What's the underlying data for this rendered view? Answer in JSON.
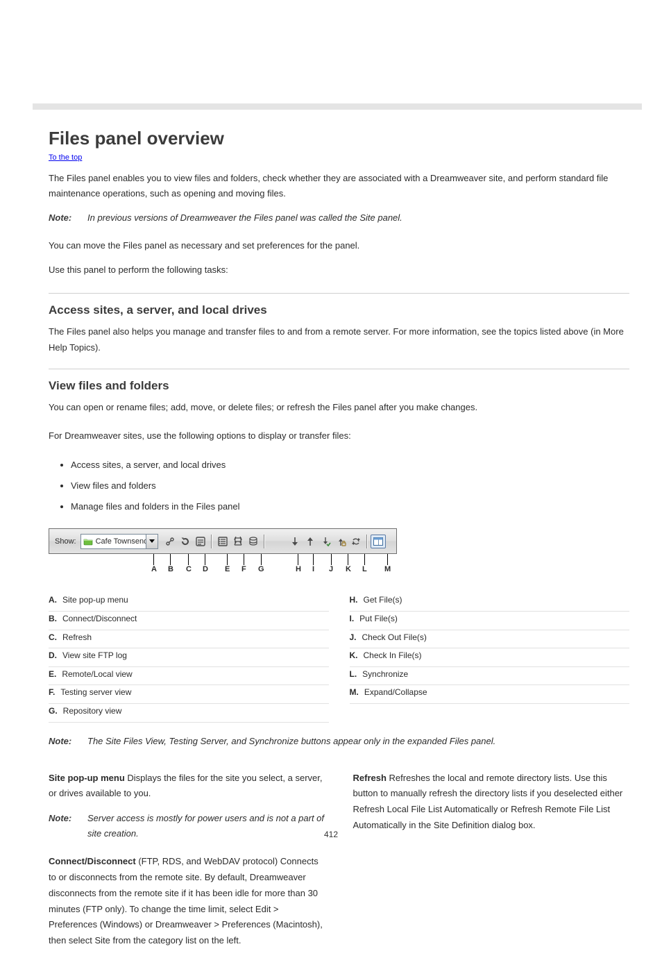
{
  "title": "Files panel overview",
  "breadcrumb_link": "To the top",
  "intro": {
    "p1a": "The Files panel enables you to view files and folders, check whether they are associated with a Dreamweaver site, and perform standard file maintenance operations, such as opening and moving files.",
    "note_label": "Note:",
    "note_body": "In previous versions of Dreamweaver the Files panel was called the Site panel.",
    "p2a": "You can move the Files panel as necessary and set preferences for the panel.",
    "p2b": "Use this panel to perform the following tasks:"
  },
  "section_access": {
    "heading": "Access sites, a server, and local drives",
    "body": "The Files panel also helps you manage and transfer files to and from a remote server. For more information, see the topics listed above (in More Help Topics)."
  },
  "section_options": {
    "heading": "View files and folders",
    "body": "You can open or rename files; add, move, or delete files; or refresh the Files panel after you make changes.",
    "p_after": "For Dreamweaver sites, use the following options to display or transfer files:",
    "bullets": [
      "Access sites, a server, and local drives",
      "View files and folders",
      "Manage files and folders in the Files panel"
    ]
  },
  "toolbar": {
    "show_label": "Show:",
    "dropdown_value": "Cafe Townsend",
    "callouts": [
      "A",
      "B",
      "C",
      "D",
      "E",
      "F",
      "G",
      "H",
      "I",
      "J",
      "K",
      "L",
      "M"
    ]
  },
  "legend": [
    {
      "k": "A.",
      "t": "Site pop-up menu"
    },
    {
      "k": "B.",
      "t": "Connect/Disconnect"
    },
    {
      "k": "C.",
      "t": "Refresh"
    },
    {
      "k": "D.",
      "t": "View site FTP log"
    },
    {
      "k": "E.",
      "t": "Remote/Local view"
    },
    {
      "k": "F.",
      "t": "Testing server view"
    },
    {
      "k": "G.",
      "t": "Repository view"
    },
    {
      "k": "H.",
      "t": "Get File(s)"
    },
    {
      "k": "I.",
      "t": "Put File(s)"
    },
    {
      "k": "J.",
      "t": "Check Out File(s)"
    },
    {
      "k": "K.",
      "t": "Check In File(s)"
    },
    {
      "k": "L.",
      "t": "Synchronize"
    },
    {
      "k": "M.",
      "t": "Expand/Collapse"
    }
  ],
  "postnote_label": "Note:",
  "postnote_body": "The Site Files View, Testing Server, and Synchronize buttons appear only in the expanded Files panel.",
  "defs": {
    "site_popup": {
      "h": "Site pop-up menu",
      "b": "Displays the files for the site you select, a server, or drives available to you."
    },
    "note2_label": "Note:",
    "note2_body": "Server access is mostly for power users and is not a part of site creation.",
    "connect": {
      "h": "Connect/Disconnect",
      "b": "(FTP, RDS, and WebDAV protocol) Connects to or disconnects from the remote site. By default, Dreamweaver disconnects from the remote site if it has been idle for more than 30 minutes (FTP only). To change the time limit, select Edit > Preferences (Windows) or Dreamweaver > Preferences (Macintosh), then select Site from the category list on the left."
    },
    "refresh": {
      "h": "Refresh",
      "b": "Refreshes the local and remote directory lists. Use this button to manually refresh the directory lists if you deselected either Refresh Local File List Automatically or Refresh Remote File List Automatically in the Site Definition dialog box."
    }
  },
  "page_number": "412"
}
